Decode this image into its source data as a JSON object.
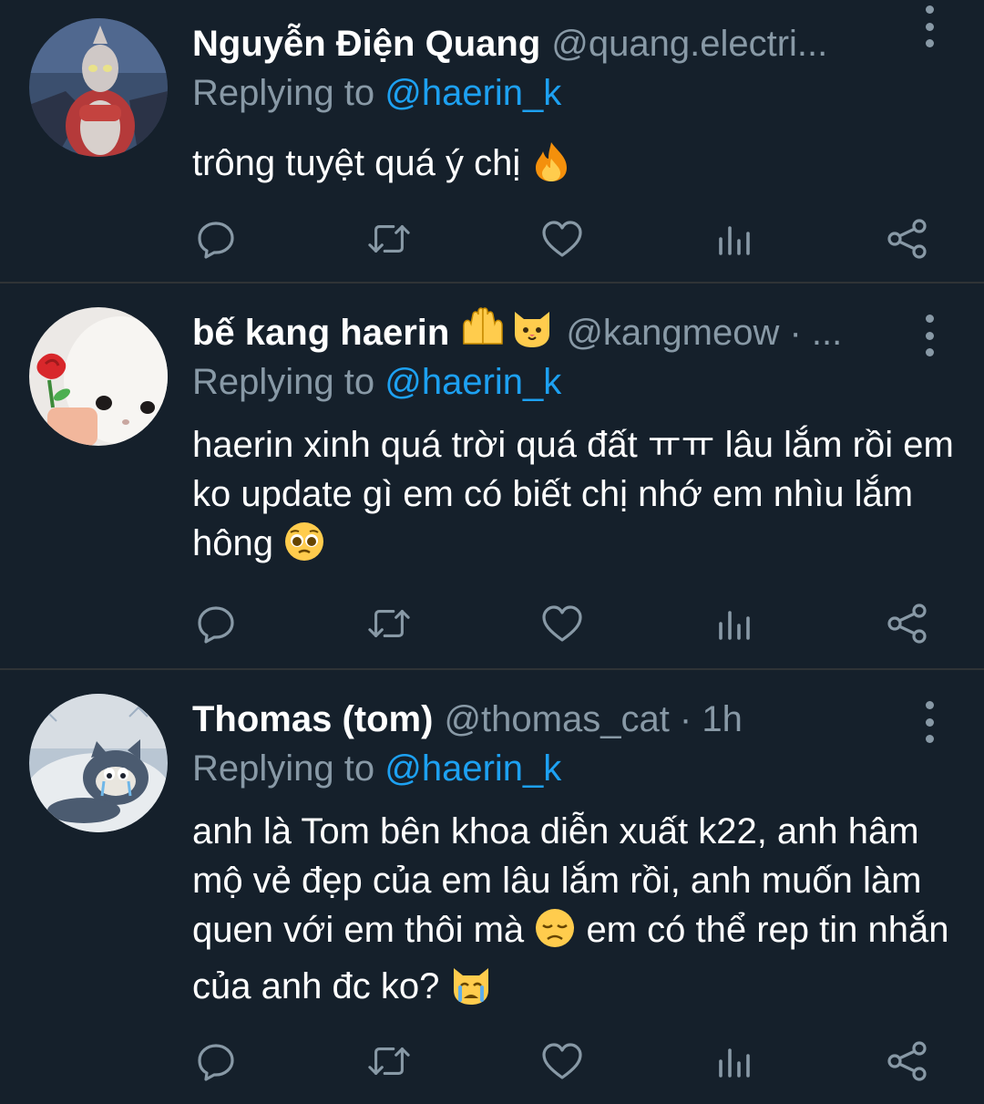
{
  "tweets": [
    {
      "name": "Nguyễn Điện Quang",
      "handle": "@quang.electri...",
      "replying_label": "Replying to",
      "replying_handle": "@haerin_k",
      "text": "trông tuyệt quá ý chị",
      "text_emoji": "fire-emoji",
      "avatar": "ultraman-figure-avatar"
    },
    {
      "name": "bế kang haerin",
      "name_emojis": [
        "palms-up-emoji",
        "cat-face-emoji"
      ],
      "handle": "@kangmeow · ...",
      "replying_label": "Replying to",
      "replying_handle": "@haerin_k",
      "text": "haerin xinh quá trời quá đất ㅠㅠ lâu lắm rồi em ko update gì em có biết chị nhớ em nhìu lắm hông",
      "text_emoji": "pleading-face-emoji",
      "avatar": "white-cat-with-rose-avatar"
    },
    {
      "name": "Thomas (tom)",
      "handle": "@thomas_cat · 1h",
      "replying_label": "Replying to",
      "replying_handle": "@haerin_k",
      "text_part1": "anh là Tom bên khoa diễn xuất k22, anh hâm mộ vẻ đẹp của em lâu lắm rồi, anh muốn làm quen với em thôi mà",
      "text_part2": "em có thể rep tin nhắn của anh đc ko?",
      "text_emojis": [
        "disappointed-face-emoji",
        "crying-cat-emoji"
      ],
      "avatar": "tom-cat-crying-in-bed-avatar"
    }
  ],
  "action_icons": [
    "reply-icon",
    "retweet-icon",
    "like-icon",
    "analytics-icon",
    "share-icon"
  ],
  "colors": {
    "background": "#15202b",
    "primary_text": "#ffffff",
    "secondary_text": "#8899a6",
    "link": "#1da1f2",
    "divider": "#2f3336"
  }
}
